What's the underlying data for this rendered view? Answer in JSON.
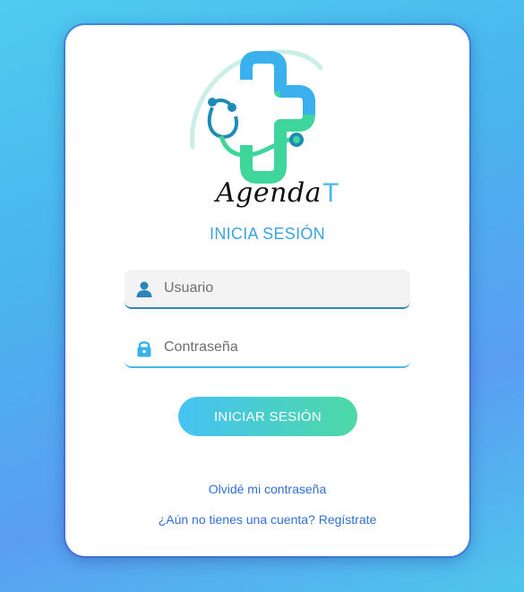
{
  "brand": {
    "name_main": "Agenda",
    "name_accent": "T"
  },
  "login": {
    "title": "INICIA SESIÓN",
    "username_placeholder": "Usuario",
    "password_placeholder": "Contraseña",
    "submit_label": "INICIAR SESIÓN",
    "forgot_link": "Olvidé mi contraseña",
    "register_link": "¿Aún no tienes una cuenta? Regístrate"
  },
  "icons": {
    "username": "user-icon",
    "password": "lock-icon",
    "logo": "medical-cross-stethoscope-logo"
  },
  "colors": {
    "accent_blue": "#3aa3e0",
    "accent_green": "#4dd9a4",
    "link": "#2f6fd6"
  }
}
